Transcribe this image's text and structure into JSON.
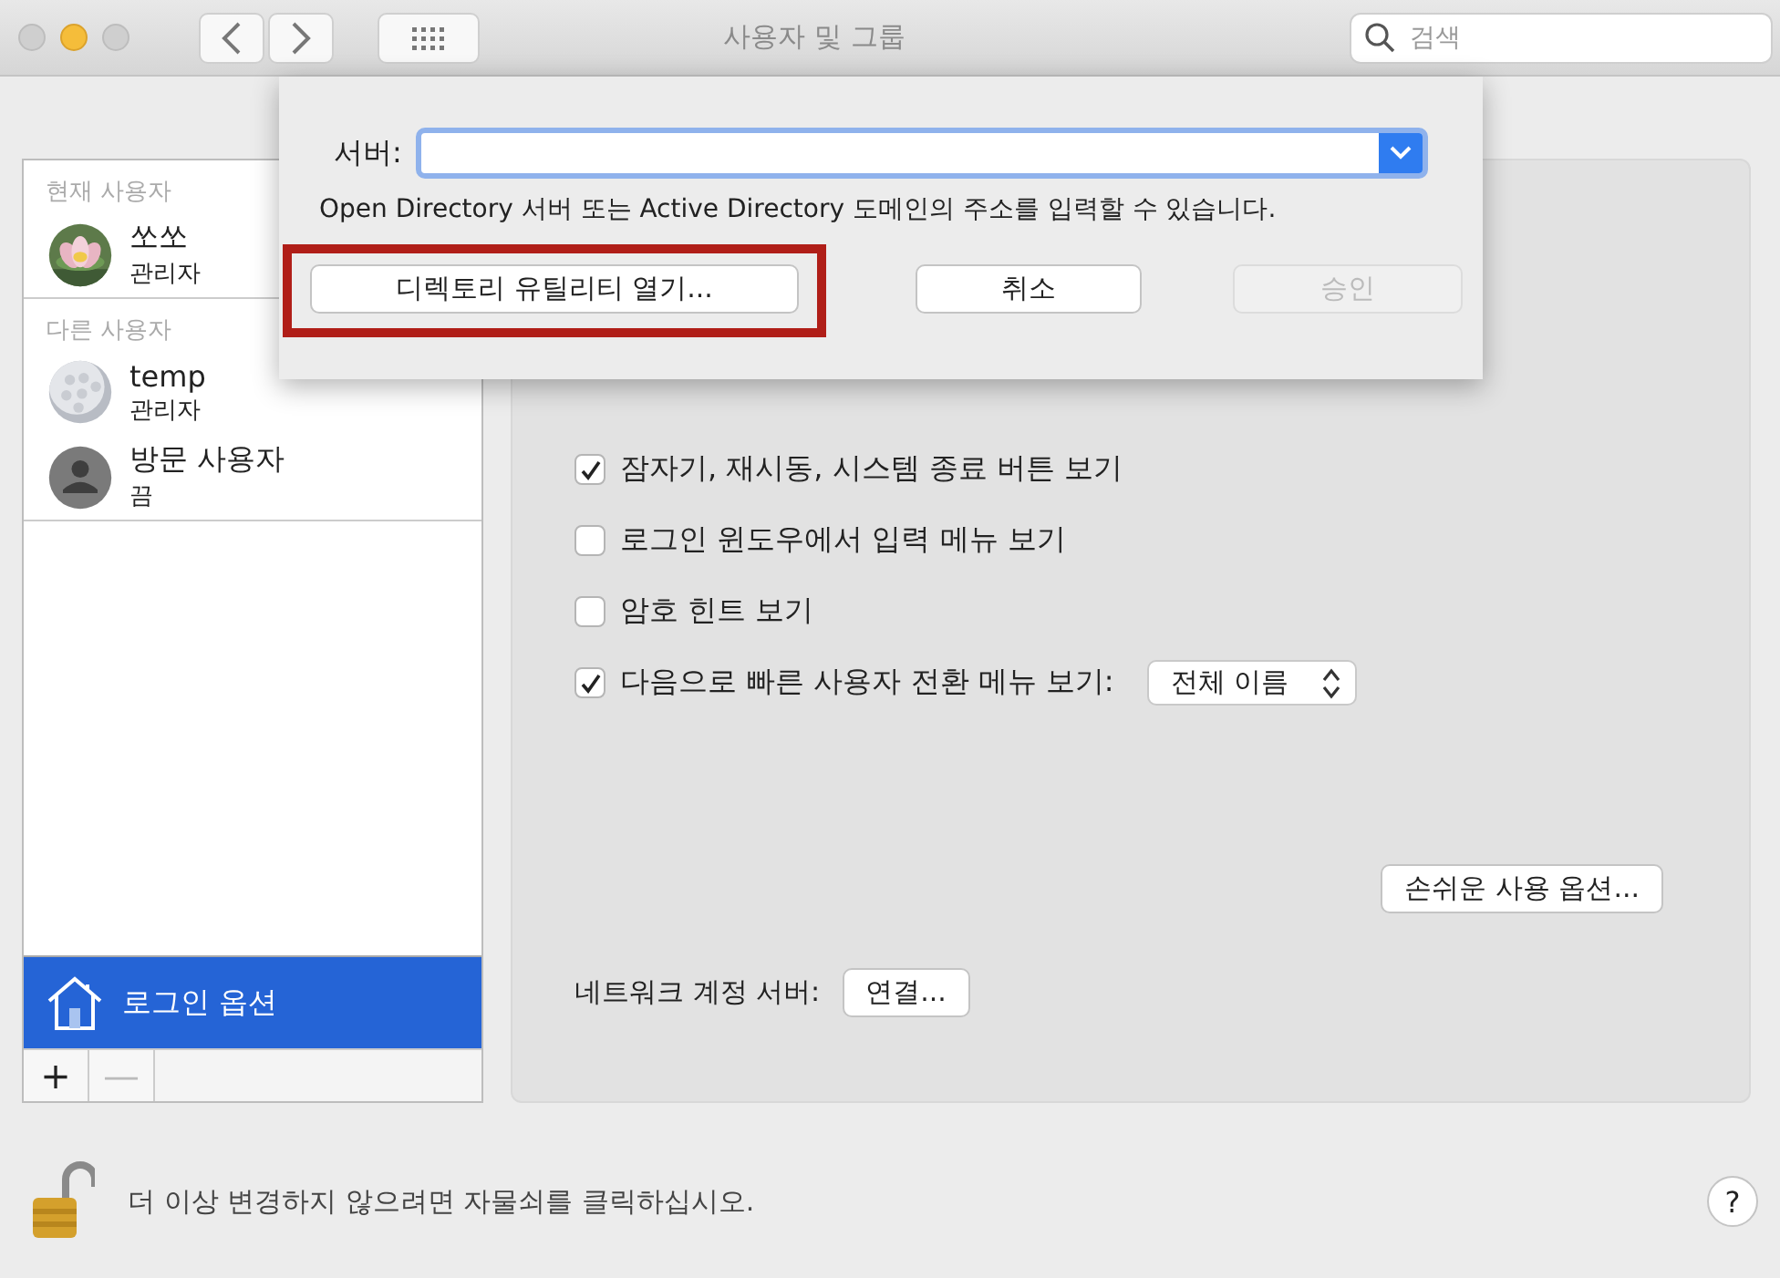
{
  "window": {
    "title": "사용자 및 그룹"
  },
  "search": {
    "placeholder": "검색"
  },
  "sheet": {
    "server_label": "서버:",
    "hint": "Open Directory 서버 또는 Active Directory 도메인의 주소를 입력할 수 있습니다.",
    "buttons": [
      {
        "label": "디렉토리 유틸리티 열기...",
        "highlighted": true,
        "disabled": false
      },
      {
        "label": "취소",
        "highlighted": false,
        "disabled": false
      },
      {
        "label": "승인",
        "highlighted": false,
        "disabled": true
      }
    ]
  },
  "sidebar": {
    "sections": [
      {
        "title": "현재 사용자",
        "users": [
          {
            "name": "쏘쏘",
            "role": "관리자",
            "kind": "picture"
          }
        ]
      },
      {
        "title": "다른 사용자",
        "users": [
          {
            "name": "temp",
            "role": "관리자",
            "kind": "picture"
          },
          {
            "name": "방문 사용자",
            "role": "끔",
            "kind": "silhouette"
          }
        ]
      }
    ],
    "login_options": {
      "label": "로그인 옵션",
      "selected": true
    },
    "add_button": {
      "label": "+",
      "disabled": false
    },
    "remove_button": {
      "label": "—",
      "disabled": true
    }
  },
  "options": [
    {
      "label": "잠자기, 재시동, 시스템 종료 버튼 보기",
      "checked": true
    },
    {
      "label": "로그인 윈도우에서 입력 메뉴 보기",
      "checked": false
    },
    {
      "label": "암호 힌트 보기",
      "checked": false
    },
    {
      "label": "다음으로 빠른 사용자 전환 메뉴 보기:",
      "checked": true,
      "popup": "전체 이름"
    }
  ],
  "accessibility_button": "손쉬운 사용 옵션...",
  "network": {
    "label": "네트워크 계정 서버:",
    "button": "연결..."
  },
  "footer": {
    "text": "더 이상 변경하지 않으려면 자물쇠를 클릭하십시오.",
    "help": "?"
  }
}
